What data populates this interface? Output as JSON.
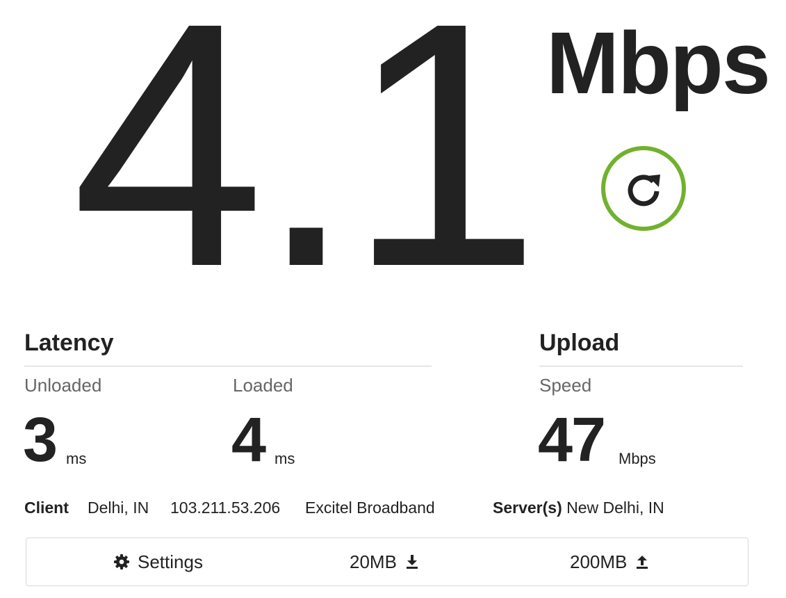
{
  "speed": {
    "value": "4.1",
    "unit": "Mbps"
  },
  "refresh": {
    "icon": "refresh-icon",
    "ring_color": "#72b12e"
  },
  "latency": {
    "title": "Latency",
    "unloaded": {
      "label": "Unloaded",
      "value": "3",
      "unit": "ms"
    },
    "loaded": {
      "label": "Loaded",
      "value": "4",
      "unit": "ms"
    }
  },
  "upload": {
    "title": "Upload",
    "speed": {
      "label": "Speed",
      "value": "47",
      "unit": "Mbps"
    }
  },
  "client": {
    "label": "Client",
    "location": "Delhi, IN",
    "ip": "103.211.53.206",
    "isp": "Excitel Broadband"
  },
  "server": {
    "label": "Server(s)",
    "location": "New Delhi, IN"
  },
  "footer": {
    "settings_label": "Settings",
    "settings_icon": "gear-icon",
    "download_size": "20MB",
    "download_icon": "download-icon",
    "upload_size": "200MB",
    "upload_icon": "upload-icon"
  }
}
